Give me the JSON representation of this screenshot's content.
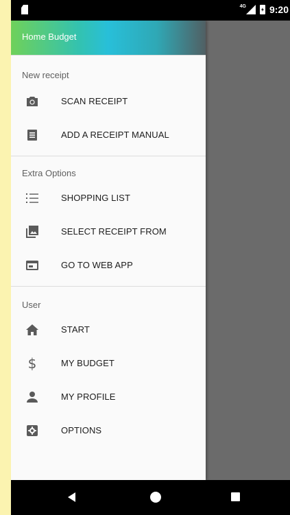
{
  "status": {
    "network": "4G",
    "time": "9:20"
  },
  "drawer": {
    "title": "Home Budget",
    "sections": [
      {
        "header": "New receipt",
        "items": [
          {
            "label": "SCAN RECEIPT",
            "icon": "camera-icon"
          },
          {
            "label": "ADD A RECEIPT MANUAL",
            "icon": "list-document-icon"
          }
        ]
      },
      {
        "header": "Extra Options",
        "items": [
          {
            "label": "SHOPPING LIST",
            "icon": "numbered-list-icon"
          },
          {
            "label": "SELECT RECEIPT FROM",
            "icon": "photo-library-icon"
          },
          {
            "label": "GO TO WEB APP",
            "icon": "web-app-icon"
          }
        ]
      },
      {
        "header": "User",
        "items": [
          {
            "label": "START",
            "icon": "home-icon"
          },
          {
            "label": "MY BUDGET",
            "icon": "dollar-icon"
          },
          {
            "label": "MY PROFILE",
            "icon": "person-icon"
          },
          {
            "label": "OPTIONS",
            "icon": "settings-icon"
          }
        ]
      }
    ]
  },
  "colors": {
    "scrim": "#6b6b6b",
    "icon": "#5a5a5a",
    "text": "#1c1c1c"
  }
}
